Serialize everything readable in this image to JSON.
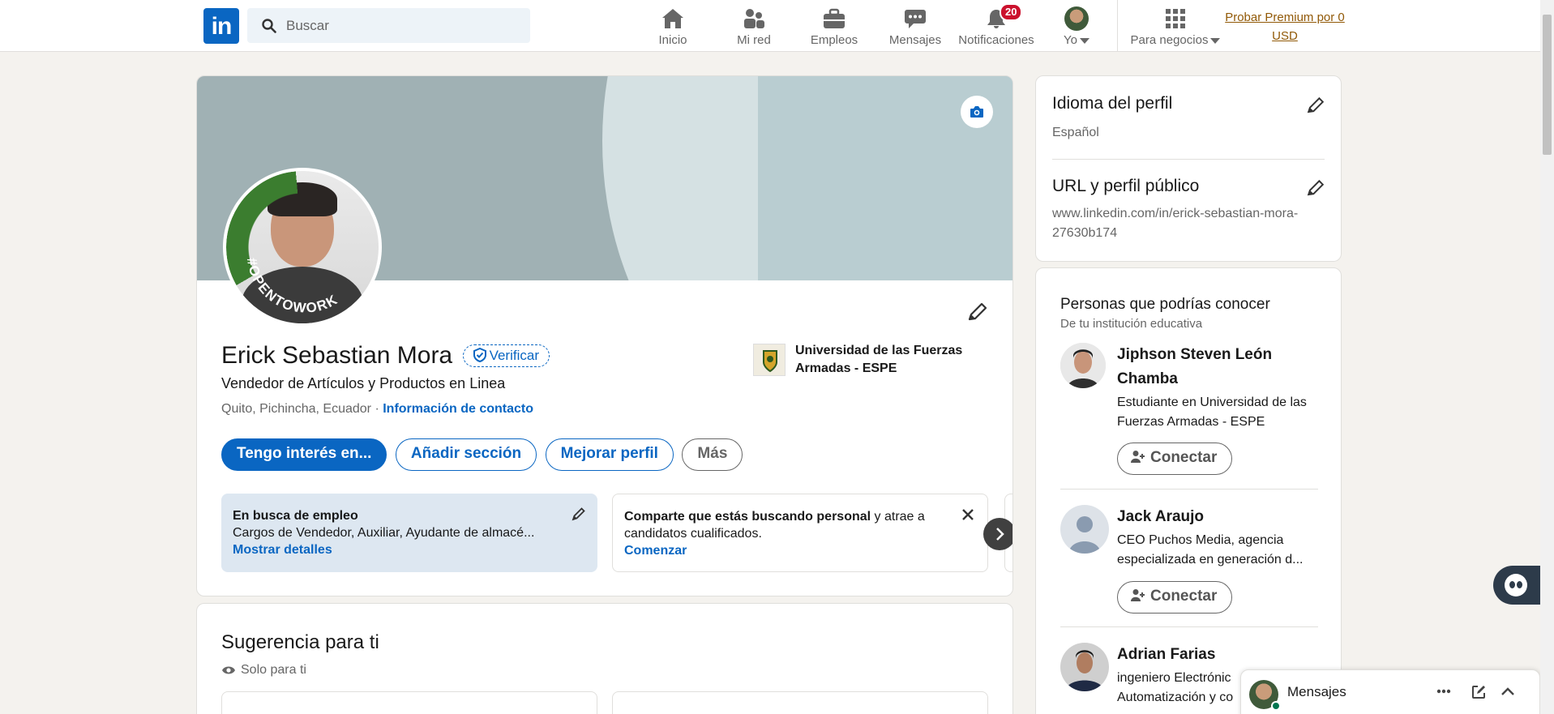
{
  "nav": {
    "logo": "in",
    "search_placeholder": "Buscar",
    "items": [
      {
        "label": "Inicio",
        "icon": "home-icon"
      },
      {
        "label": "Mi red",
        "icon": "network-icon"
      },
      {
        "label": "Empleos",
        "icon": "briefcase-icon"
      },
      {
        "label": "Mensajes",
        "icon": "chat-icon"
      },
      {
        "label": "Notificaciones",
        "icon": "bell-icon",
        "badge": "20"
      },
      {
        "label": "Yo",
        "icon": "avatar"
      }
    ],
    "business_label": "Para negocios",
    "premium_line1": "Probar Premium por 0",
    "premium_line2": "USD"
  },
  "profile": {
    "name": "Erick Sebastian Mora",
    "verify_label": "Verificar",
    "headline": "Vendedor de Artículos y Productos en Linea",
    "location": "Quito, Pichincha, Ecuador",
    "location_sep": "·",
    "contact_link": "Información de contacto",
    "opentowork_text": "#OPENTOWORK",
    "education": "Universidad de las Fuerzas Armadas - ESPE",
    "buttons": {
      "interest": "Tengo interés en...",
      "add_section": "Añadir sección",
      "improve": "Mejorar perfil",
      "more": "Más"
    },
    "open_to_work": {
      "title": "En busca de empleo",
      "detail": "Cargos de Vendedor, Auxiliar, Ayudante de almacé...",
      "link": "Mostrar detalles"
    },
    "hiring": {
      "bold": "Comparte que estás buscando personal",
      "rest": " y atrae a candidatos cualificados.",
      "link": "Comenzar"
    }
  },
  "suggestions": {
    "title": "Sugerencia para ti",
    "subtitle": "Solo para ti"
  },
  "sidebar": {
    "language_title": "Idioma del perfil",
    "language_value": "Español",
    "url_title": "URL y perfil público",
    "url_value": "www.linkedin.com/in/erick-sebastian-mora-27630b174"
  },
  "people": {
    "title": "Personas que podrías conocer",
    "subtitle": "De tu institución educativa",
    "connect_label": "Conectar",
    "list": [
      {
        "name": "Jiphson Steven León Chamba",
        "desc": "Estudiante en Universidad de las Fuerzas Armadas - ESPE"
      },
      {
        "name": "Jack Araujo",
        "desc": "CEO Puchos Media, agencia especializada en generación d..."
      },
      {
        "name": "Adrian Farias",
        "desc": "ingeniero Electrónic Automatización y co"
      }
    ]
  },
  "messaging": {
    "label": "Mensajes"
  },
  "colors": {
    "brand": "#0a66c2",
    "badge": "#cb112d",
    "premium": "#915907",
    "opentowork": "#3b7d2f"
  }
}
